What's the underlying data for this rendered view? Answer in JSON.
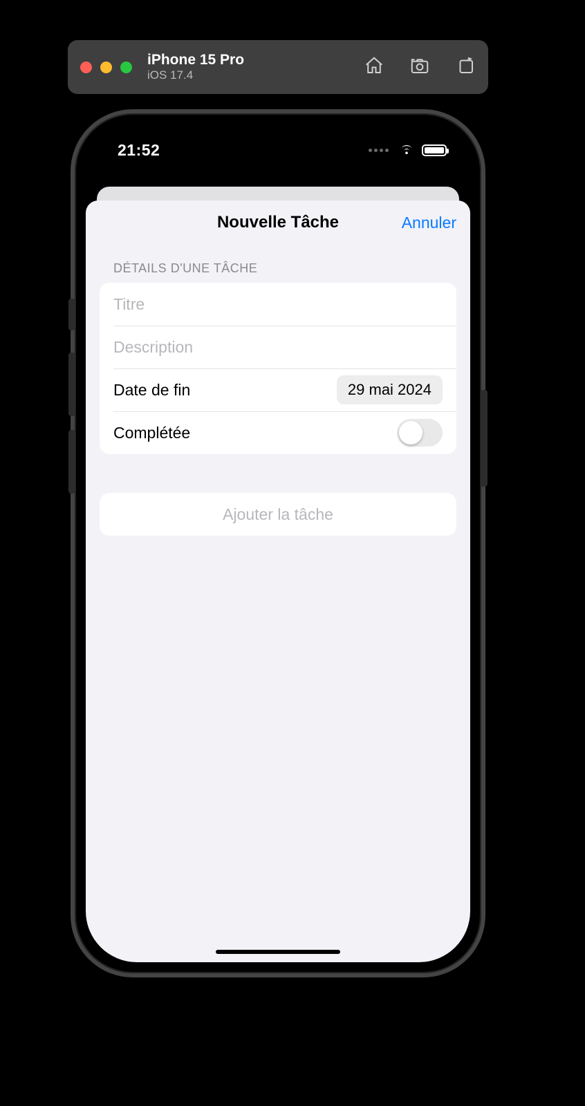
{
  "simulator": {
    "device": "iPhone 15 Pro",
    "os": "iOS 17.4"
  },
  "status": {
    "time": "21:52"
  },
  "sheet": {
    "title": "Nouvelle Tâche",
    "cancel": "Annuler"
  },
  "form": {
    "section_header": "Détails d'une tâche",
    "title_placeholder": "Titre",
    "title_value": "",
    "description_placeholder": "Description",
    "description_value": "",
    "due_label": "Date de fin",
    "due_value": "29 mai 2024",
    "completed_label": "Complétée",
    "completed": false,
    "add_button": "Ajouter la tâche"
  }
}
